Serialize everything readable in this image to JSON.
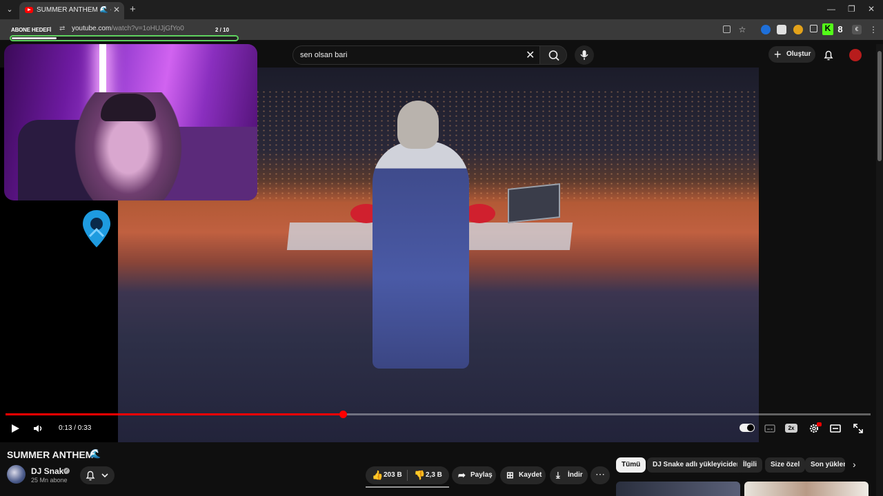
{
  "browser": {
    "tab_title": "SUMMER ANTHEM 🌊 - YouTube",
    "url_domain": "youtube.com",
    "url_path": "/watch?v=1oHUJjGfYo0",
    "new_tab_label": "+",
    "tab_close_label": "✕"
  },
  "overlay": {
    "goal_label": "ABONE HEDEFİ",
    "goal_count": "2  / 10",
    "goal_progress": 0.2
  },
  "youtube": {
    "search_value": "sen olsan bari",
    "create_label": "Oluştur",
    "video": {
      "current_time": "0:13",
      "duration": "0:33",
      "time_display": "0:13 / 0:33",
      "progress": 0.39,
      "speed_badge": "2x"
    },
    "title": "SUMMER ANTHEM",
    "title_emoji": "🌊",
    "channel": {
      "name": "DJ Snake",
      "subscribers": "25 Mn abone"
    },
    "actions": {
      "likes": "203 B",
      "dislikes": "2,3 B",
      "share": "Paylaş",
      "save": "Kaydet",
      "download": "İndir",
      "more": "⋯"
    },
    "chips": [
      "Tümü",
      "DJ Snake adlı yükleyiciden",
      "İlgili",
      "Size özel",
      "Son yüklenenler"
    ],
    "colors": {
      "accent": "#ff0000",
      "bg": "#0f0f0f",
      "goal_border": "#5fd25f"
    }
  }
}
